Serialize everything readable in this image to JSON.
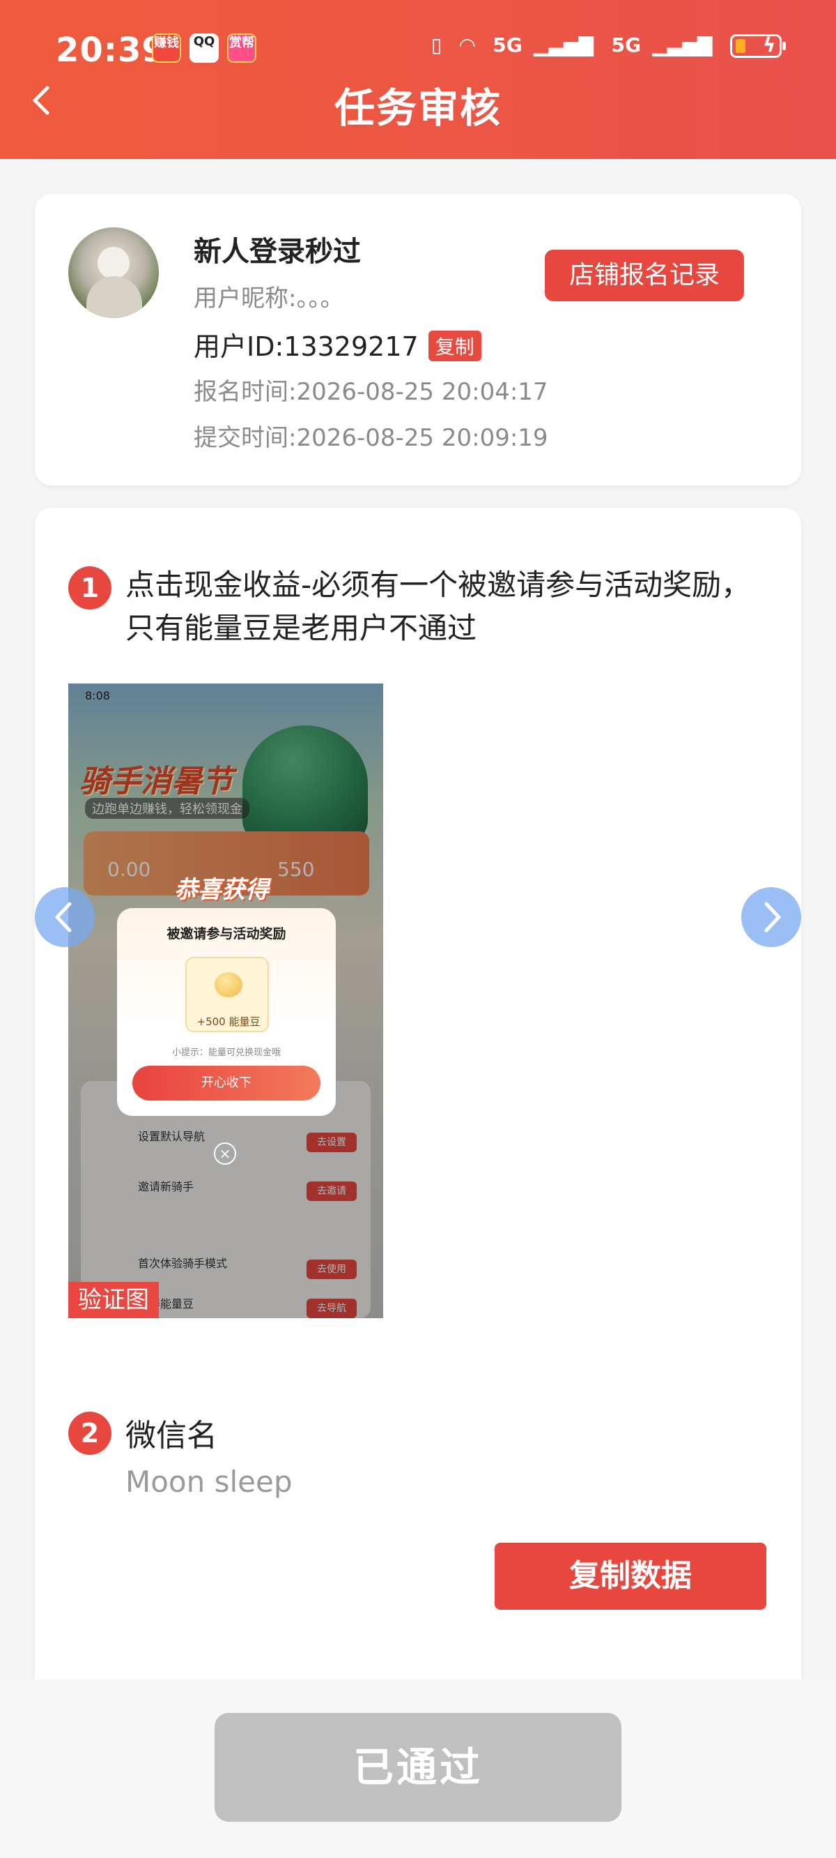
{
  "status_bar": {
    "time": "20:39",
    "apps": [
      "赚钱",
      "QQ",
      "赏帮"
    ],
    "network": "5G",
    "network2": "5G"
  },
  "header": {
    "title": "任务审核",
    "back_icon": "chevron-left-icon"
  },
  "user_card": {
    "task_name": "新人登录秒过",
    "nickname": "用户昵称:。。。",
    "user_id": "用户ID:13329217",
    "copy_tag": "复制",
    "register_time": "报名时间:2026-08-25 20:04:17",
    "submit_time": "提交时间:2026-08-25 20:09:19",
    "store_button": "店铺报名记录"
  },
  "task": {
    "step1": {
      "number": "1",
      "text": "点击现金收益-必须有一个被邀请参与活动奖励，只有能量豆是老用户不通过"
    },
    "proof": {
      "status_time": "8:08",
      "banner": "骑手消暑节",
      "subtitle": "边跑单边赚钱，轻松领现金",
      "cash_value": "0.00",
      "bean_value": "550",
      "congrats": "恭喜获得",
      "popup_title": "被邀请参与活动奖励",
      "popup_reward": "+500 能量豆",
      "popup_tip": "小提示：能量可兑换现金哦",
      "popup_button": "开心收下",
      "list": [
        {
          "title": "设置默认导航",
          "button": "去设置"
        },
        {
          "title": "邀请新骑手",
          "button": "去邀请"
        },
        {
          "title": "首次体验骑手模式",
          "button": "去使用"
        },
        {
          "title": "航得能量豆",
          "button": "去导航"
        }
      ],
      "verify_label": "验证图"
    },
    "step2": {
      "number": "2",
      "label": "微信名",
      "value": "Moon sleep"
    },
    "copy_data_button": "复制数据"
  },
  "bottom": {
    "passed_button": "已通过"
  },
  "colors": {
    "header": "#ef5b3c",
    "accent": "#e8473f",
    "disabled": "#c0c0c0"
  }
}
